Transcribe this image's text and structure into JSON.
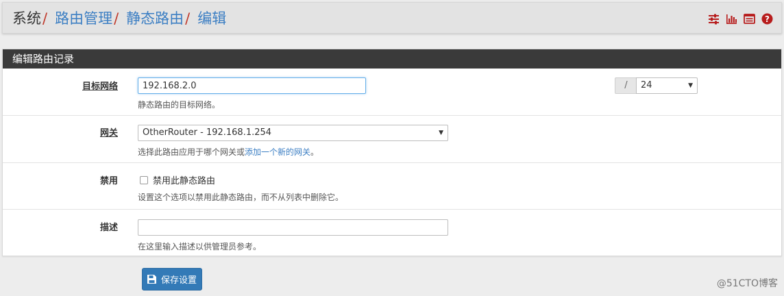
{
  "breadcrumb": {
    "root": "系统",
    "items": [
      "路由管理",
      "静态路由",
      "编辑"
    ],
    "separator": "/"
  },
  "header_icons": [
    "sliders-icon",
    "bar-chart-icon",
    "list-icon",
    "help-icon"
  ],
  "colors": {
    "accent": "#3b7ec3",
    "separator": "#c0392b",
    "panel_heading": "#3a3a3a",
    "button": "#337ab7",
    "icon_red": "#b71c1c"
  },
  "panel": {
    "title": "编辑路由记录"
  },
  "form": {
    "destination": {
      "label": "目标网络",
      "value": "192.168.2.0",
      "mask_separator": "/",
      "mask_value": "24",
      "help": "静态路由的目标网络。"
    },
    "gateway": {
      "label": "网关",
      "value": "OtherRouter - 192.168.1.254",
      "help_prefix": "选择此路由应用于哪个网关或",
      "help_link": "添加一个新的网关",
      "help_suffix": "。"
    },
    "disabled": {
      "label": "禁用",
      "checkbox_label": "禁用此静态路由",
      "checked": false,
      "help": "设置这个选项以禁用此静态路由，而不从列表中删除它。"
    },
    "description": {
      "label": "描述",
      "value": "",
      "help": "在这里输入描述以供管理员参考。"
    }
  },
  "save_button": {
    "label": "保存设置",
    "icon": "save-icon"
  },
  "watermark": "@51CTO博客"
}
